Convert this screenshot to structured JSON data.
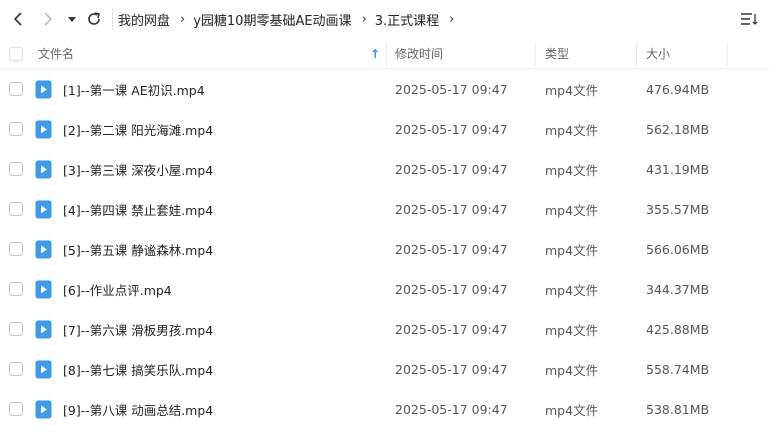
{
  "toolbar": {
    "back_icon": "chevron-left-icon",
    "forward_icon": "chevron-right-icon",
    "dropdown_icon": "caret-down-icon",
    "refresh_icon": "refresh-icon",
    "view_icon": "sort-list-icon"
  },
  "breadcrumb": [
    "我的网盘",
    "y园糖10期零基础AE动画课",
    "3.正式课程"
  ],
  "columns": {
    "name": "文件名",
    "modified": "修改时间",
    "type": "类型",
    "size": "大小",
    "sort_indicator": "↑"
  },
  "colors": {
    "accent": "#2f8cf0",
    "icon_blue": "#3d9be9"
  },
  "files": [
    {
      "name": "[1]--第一课 AE初识.mp4",
      "modified": "2025-05-17 09:47",
      "type": "mp4文件",
      "size": "476.94MB"
    },
    {
      "name": "[2]--第二课 阳光海滩.mp4",
      "modified": "2025-05-17 09:47",
      "type": "mp4文件",
      "size": "562.18MB"
    },
    {
      "name": "[3]--第三课 深夜小屋.mp4",
      "modified": "2025-05-17 09:47",
      "type": "mp4文件",
      "size": "431.19MB"
    },
    {
      "name": "[4]--第四课 禁止套娃.mp4",
      "modified": "2025-05-17 09:47",
      "type": "mp4文件",
      "size": "355.57MB"
    },
    {
      "name": "[5]--第五课 静谧森林.mp4",
      "modified": "2025-05-17 09:47",
      "type": "mp4文件",
      "size": "566.06MB"
    },
    {
      "name": "[6]--作业点评.mp4",
      "modified": "2025-05-17 09:47",
      "type": "mp4文件",
      "size": "344.37MB"
    },
    {
      "name": "[7]--第六课 滑板男孩.mp4",
      "modified": "2025-05-17 09:47",
      "type": "mp4文件",
      "size": "425.88MB"
    },
    {
      "name": "[8]--第七课 搞笑乐队.mp4",
      "modified": "2025-05-17 09:47",
      "type": "mp4文件",
      "size": "558.74MB"
    },
    {
      "name": "[9]--第八课 动画总结.mp4",
      "modified": "2025-05-17 09:47",
      "type": "mp4文件",
      "size": "538.81MB"
    }
  ]
}
